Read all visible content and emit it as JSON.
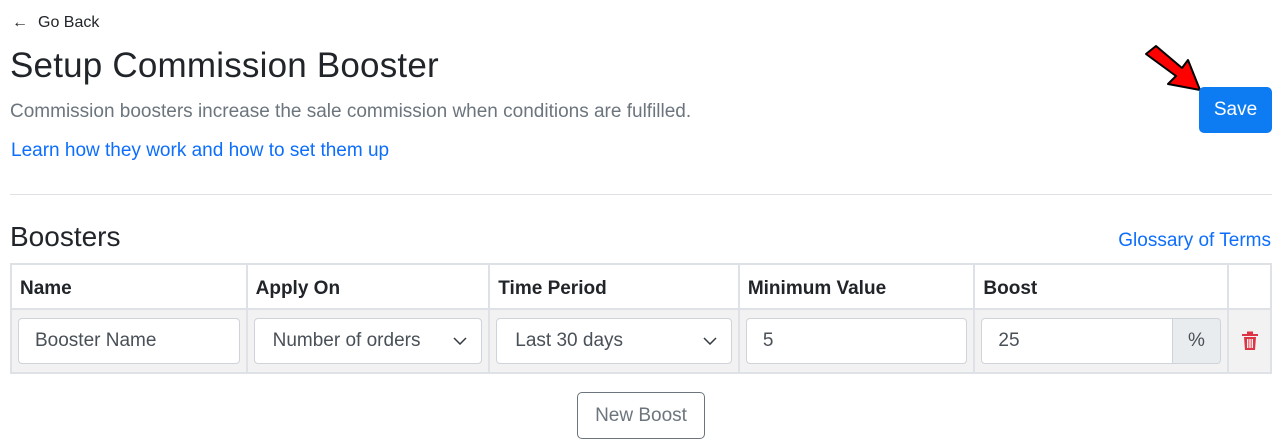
{
  "nav": {
    "back_arrow": "←",
    "back_label": "Go Back"
  },
  "header": {
    "title": "Setup Commission Booster",
    "subtitle": "Commission boosters increase the sale commission when conditions are fulfilled.",
    "help_link": "Learn how they work and how to set them up",
    "save_label": "Save"
  },
  "section": {
    "title": "Boosters",
    "glossary_link": "Glossary of Terms"
  },
  "table": {
    "columns": [
      "Name",
      "Apply On",
      "Time Period",
      "Minimum Value",
      "Boost"
    ],
    "rows": [
      {
        "name_placeholder": "Booster Name",
        "apply_on": "Number of orders",
        "time_period": "Last 30 days",
        "minimum_value": "5",
        "boost": "25",
        "boost_unit": "%"
      }
    ]
  },
  "actions": {
    "new_boost_label": "New Boost"
  },
  "icons": {
    "back": "arrow-left-icon",
    "chevron": "chevron-down-icon",
    "delete": "trash-icon",
    "annotation": "red-arrow-icon"
  },
  "colors": {
    "primary": "#0d7bf2",
    "link": "#0d6efd",
    "danger": "#dc3545",
    "annotation": "#ff0000"
  }
}
